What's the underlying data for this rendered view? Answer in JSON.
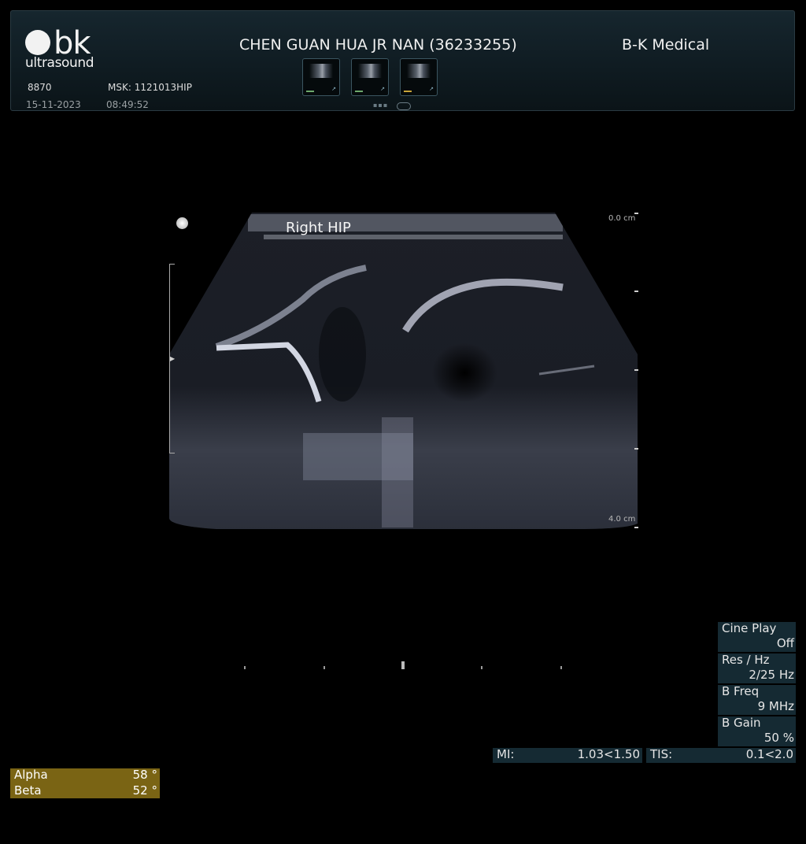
{
  "header": {
    "logo": {
      "brand_mark": "bk",
      "brand_sub": "ultrasound"
    },
    "id_code": "8870",
    "preset": "MSK: 1121013HIP",
    "date": "15-11-2023",
    "time": "08:49:52",
    "patient": "CHEN GUAN HUA JR NAN (36233255)",
    "institution": "B-K Medical",
    "thumbnails": [
      {
        "marker": "green"
      },
      {
        "marker": "green"
      },
      {
        "marker": "yellow"
      }
    ]
  },
  "image": {
    "label": "Right HIP",
    "depth_top": "0.0 cm",
    "depth_bottom": "4.0 cm"
  },
  "params": [
    {
      "label": "Cine Play",
      "value": "Off"
    },
    {
      "label": "Res / Hz",
      "value": "2/25 Hz"
    },
    {
      "label": "B Freq",
      "value": "9 MHz"
    },
    {
      "label": "B Gain",
      "value": "50 %"
    }
  ],
  "safety": {
    "mi_label": "MI:",
    "mi_value": "1.03<1.50",
    "tis_label": "TIS:",
    "tis_value": "0.1<2.0"
  },
  "angles": [
    {
      "label": "Alpha",
      "value": "58 °"
    },
    {
      "label": "Beta",
      "value": "52 °"
    }
  ],
  "colors": {
    "panel": "#152a33",
    "angle_panel": "#7a6414",
    "background": "#000000"
  }
}
